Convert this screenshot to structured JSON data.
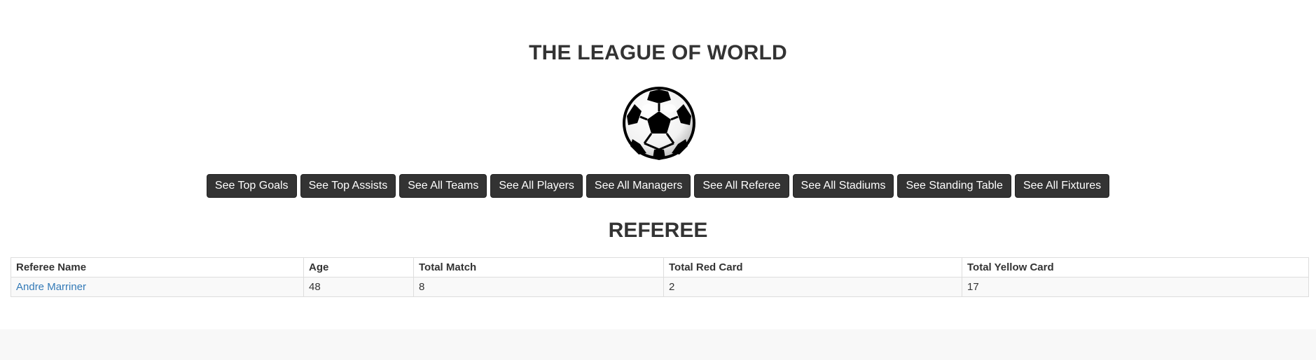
{
  "header": {
    "title": "THE LEAGUE OF WORLD"
  },
  "nav": {
    "buttons": [
      "See Top Goals",
      "See Top Assists",
      "See All Teams",
      "See All Players",
      "See All Managers",
      "See All Referee",
      "See All Stadiums",
      "See Standing Table",
      "See All Fixtures"
    ]
  },
  "section": {
    "title": "REFEREE"
  },
  "table": {
    "columns": [
      "Referee Name",
      "Age",
      "Total Match",
      "Total Red Card",
      "Total Yellow Card"
    ],
    "rows": [
      [
        "Andre Marriner",
        "48",
        "8",
        "2",
        "17"
      ]
    ]
  },
  "colors": {
    "button_bg": "#333333",
    "link": "#337ab7",
    "text": "#333333"
  },
  "icons": {
    "logo": "soccer-ball-icon"
  }
}
